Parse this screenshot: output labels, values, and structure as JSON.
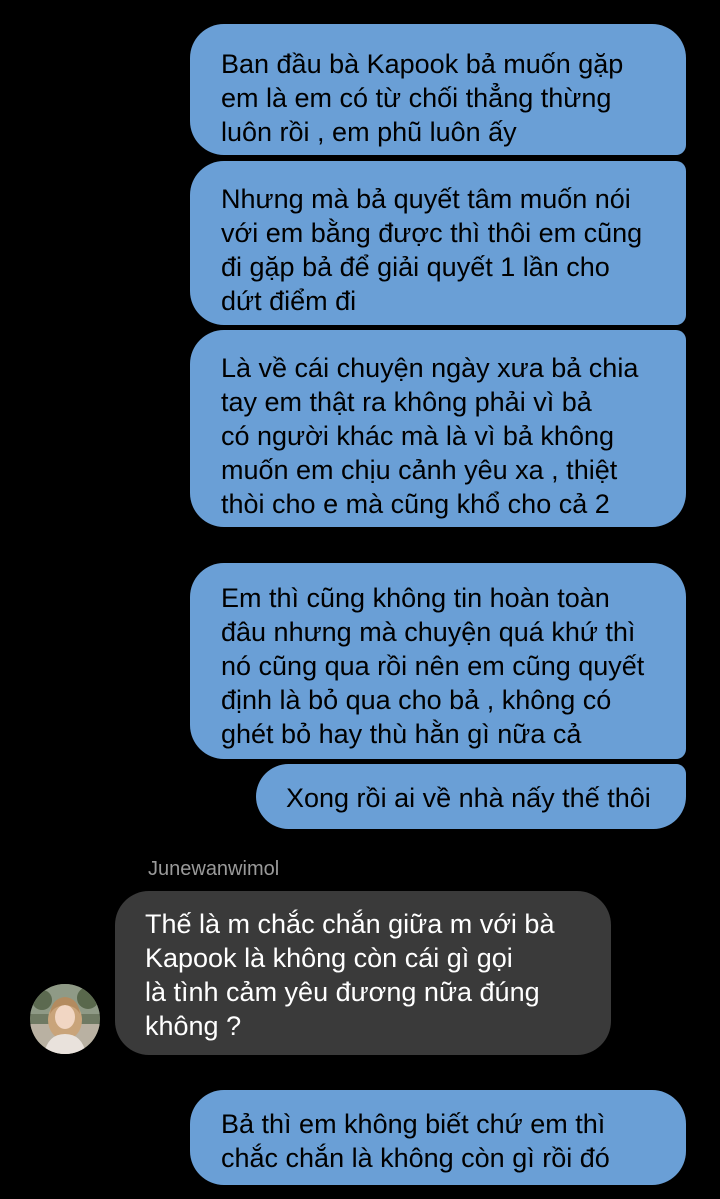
{
  "thread": {
    "messages": [
      {
        "direction": "outgoing",
        "text": "Ban đầu bà Kapook bả muốn gặp\nem là em có từ chối thẳng thừng\nluôn rồi , em phũ luôn ấy"
      },
      {
        "direction": "outgoing",
        "text": "Nhưng mà bả quyết tâm muốn nói\nvới em bằng được thì thôi em cũng\nđi gặp bả để giải quyết 1 lần cho\ndứt điểm đi"
      },
      {
        "direction": "outgoing",
        "text": "Là về cái chuyện ngày xưa bả chia\ntay em thật ra không phải vì bả\ncó người khác mà là vì bả không\nmuốn em chịu cảnh yêu xa , thiệt\nthòi cho e mà cũng khổ cho cả 2"
      },
      {
        "direction": "outgoing",
        "text": " Em thì cũng không tin hoàn toàn\nđâu nhưng mà chuyện quá khứ thì\nnó cũng qua rồi nên em cũng quyết\nđịnh là bỏ qua cho bả , không có\nghét bỏ hay thù hằn gì nữa cả"
      },
      {
        "direction": "outgoing",
        "text": "Xong rồi ai về nhà nấy thế thôi"
      },
      {
        "direction": "incoming",
        "sender": "Junewanwimol",
        "avatar_icon": "profile-photo-avatar",
        "text": "Thế là m chắc chắn giữa m với bà\nKapook là không còn cái gì gọi\nlà tình cảm yêu đương nữa đúng\nkhông ?"
      },
      {
        "direction": "outgoing",
        "text": "Bả thì em không biết chứ em thì\nchắc chắn là không còn gì rồi đó"
      }
    ]
  },
  "colors": {
    "background": "#000000",
    "outgoing_bubble": "#6a9fd6",
    "incoming_bubble": "#3a3a3a",
    "sender_name": "#9a9a9a"
  }
}
